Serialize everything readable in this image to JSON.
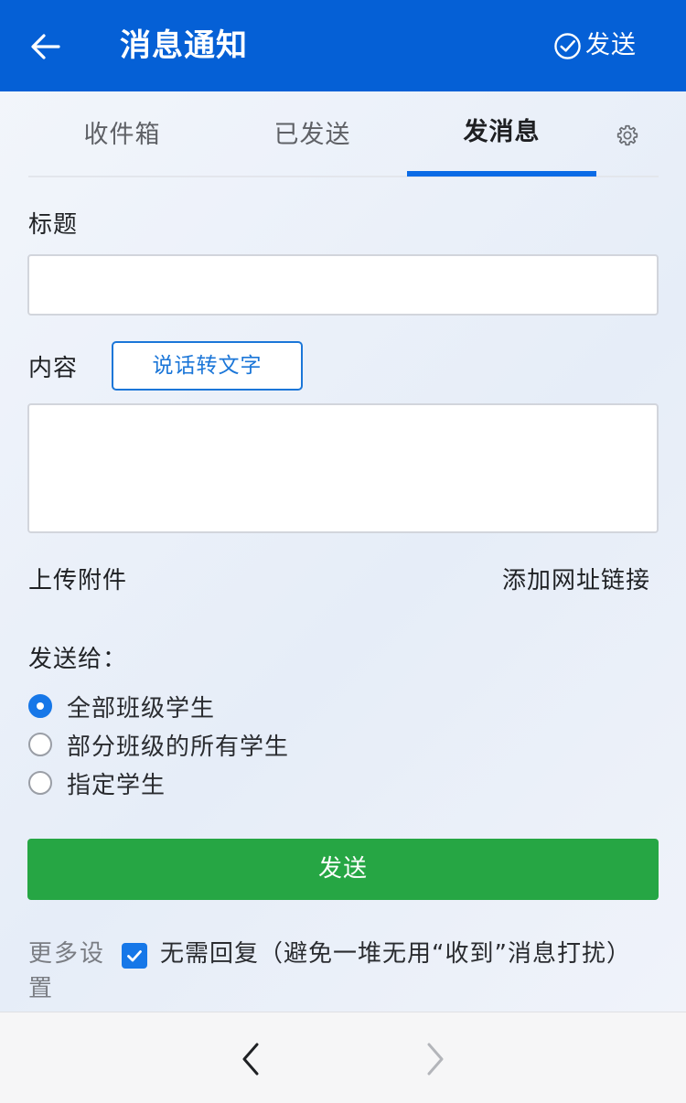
{
  "header": {
    "title": "消息通知",
    "send_label": "发送",
    "icons": {
      "back": "arrow-left-icon",
      "send": "check-circle-icon"
    },
    "color": "#0560d6"
  },
  "tabs": [
    {
      "label": "收件箱",
      "active": false
    },
    {
      "label": "已发送",
      "active": false
    },
    {
      "label": "发消息",
      "active": true
    }
  ],
  "tabs_settings_icon": "gear-icon",
  "form": {
    "title_label": "标题",
    "title_value": "",
    "content_label": "内容",
    "voice_button": "说话转文字",
    "content_value": "",
    "upload_attachment": "上传附件",
    "add_link": "添加网址链接",
    "send_to_label": "发送给：",
    "recipients": [
      {
        "label": "全部班级学生",
        "checked": true
      },
      {
        "label": "部分班级的所有学生",
        "checked": false
      },
      {
        "label": "指定学生",
        "checked": false
      }
    ],
    "submit_label": "发送",
    "more_settings_label": "更多设置",
    "no_reply_label": "无需回复（避免一堆无用“收到”消息打扰）",
    "no_reply_checked": true
  },
  "colors": {
    "accent": "#1677e8",
    "submit": "#26a644"
  },
  "bottom_nav": {
    "back_icon": "chevron-left-icon",
    "forward_icon": "chevron-right-icon"
  }
}
